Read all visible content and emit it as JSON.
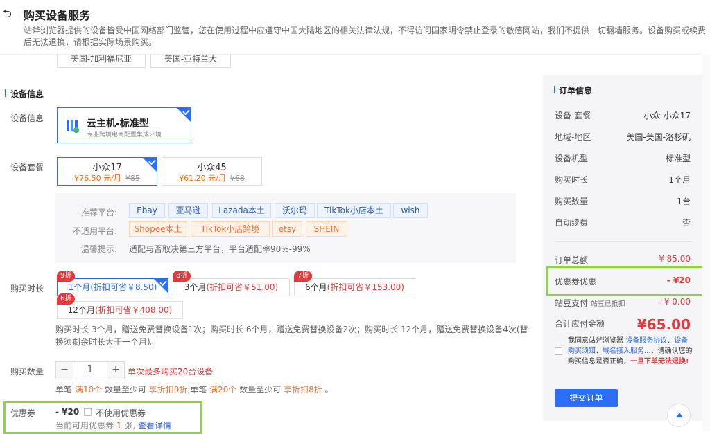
{
  "page": {
    "title": "购买设备服务",
    "notice": "站斧浏览器提供的设备皆受中国网络部门监管，您在使用过程中应遵守中国大陆地区的相关法律法规，不得访问国家明令禁止登录的敏感网站，我们不提供一切翻墙服务。设备购买或续费后无法退换，请根据实际场景购买。"
  },
  "region_tabs": [
    "美国-加利福尼亚",
    "美国-亚特兰大"
  ],
  "device_section": {
    "title": "设备信息",
    "info_label": "设备信息",
    "device_name": "云主机-标准型",
    "device_desc": "专业跨境电商配置集成环境",
    "package_label": "设备套餐",
    "packages": [
      {
        "name": "小众17",
        "price": "¥76.50 元/月",
        "original": "¥85",
        "selected": true
      },
      {
        "name": "小众45",
        "price": "¥61.20 元/月",
        "original": "¥68",
        "selected": false
      }
    ]
  },
  "platforms": {
    "recommended_label": "推荐平台:",
    "recommended": [
      "Ebay",
      "亚马逊",
      "Lazada本土",
      "沃尔玛",
      "TikTok小店本土",
      "wish"
    ],
    "unsuitable_label": "不适用平台:",
    "unsuitable": [
      "Shopee本土",
      "TikTok小店跨境",
      "etsy",
      "SHEIN"
    ],
    "tip_label": "温馨提示:",
    "tip": "适配与否取决第三方平台，平台适配率90%-99%"
  },
  "duration": {
    "label": "购买时长",
    "options": [
      {
        "badge": "9折",
        "text": "1个月",
        "save": "(折扣可省￥8.50)",
        "selected": true
      },
      {
        "badge": "8折",
        "text": "3个月",
        "save": "(折扣可省￥51.00)",
        "selected": false
      },
      {
        "badge": "7折",
        "text": "6个月",
        "save": "(折扣可省￥153.00)",
        "selected": false
      },
      {
        "badge": "6折",
        "text": "12个月",
        "save": "(折扣可省￥408.00)",
        "selected": false
      }
    ],
    "note": "购买时长 3个月，赠送免费替换设备1次；购买时长 6个月，赠送免费替换设备2次；购买时长 12个月，赠送免费替换设备4次(替换须剩余时长大于一个月)。"
  },
  "quantity": {
    "label": "购买数量",
    "minus": "−",
    "plus": "+",
    "value": "1",
    "max_tip": "单次最多购买20台设备",
    "tip_a": "单笔",
    "tip_b": "满10个",
    "tip_c": "数量至少可",
    "tip_d": "享折扣9折",
    "tip_e": ",单笔",
    "tip_f": "满20个",
    "tip_g": "数量至少可",
    "tip_h": "享折扣8折",
    "tip_i": "。"
  },
  "coupon": {
    "label": "优惠券",
    "amount": "- ¥20",
    "no_use": "不使用优惠券",
    "avail_a": "当前可用优惠券",
    "avail_count": "1",
    "avail_b": "张,",
    "detail_link": "查看详情"
  },
  "order": {
    "title": "订单信息",
    "rows": [
      {
        "label": "设备-套餐",
        "value": "小众-小众17"
      },
      {
        "label": "地域-地区",
        "value": "美国-美国-洛杉矶"
      },
      {
        "label": "设备机型",
        "value": "标准型"
      },
      {
        "label": "购买时长",
        "value": "1个月"
      },
      {
        "label": "购买数量",
        "value": "1台"
      },
      {
        "label": "自动续费",
        "value": "否"
      }
    ],
    "total_label": "订单总额",
    "total_value": "¥ 85.00",
    "coupon_label": "优惠券优惠",
    "coupon_value": "- ¥20",
    "beans_label": "站豆支付",
    "beans_sub": "站豆已抵扣",
    "beans_value": "- ¥ 0.00",
    "payable_label": "合计应付金额",
    "payable_value": "¥65.00",
    "agree_a": "我同意站斧浏览器",
    "agree_link1": "设备服务协议",
    "agree_b": "、",
    "agree_link2": "设备购买须知",
    "agree_c": "、",
    "agree_link3": "域名接入服务...",
    "agree_d": "，请确认您的购买信息是否正确，",
    "agree_e": "一旦下单无法退换!",
    "submit": "提交订单"
  },
  "colors": {
    "accent": "#2a6ef5",
    "price": "#e4393c",
    "orange": "#ff6a00",
    "highlight": "#8fd14f"
  }
}
